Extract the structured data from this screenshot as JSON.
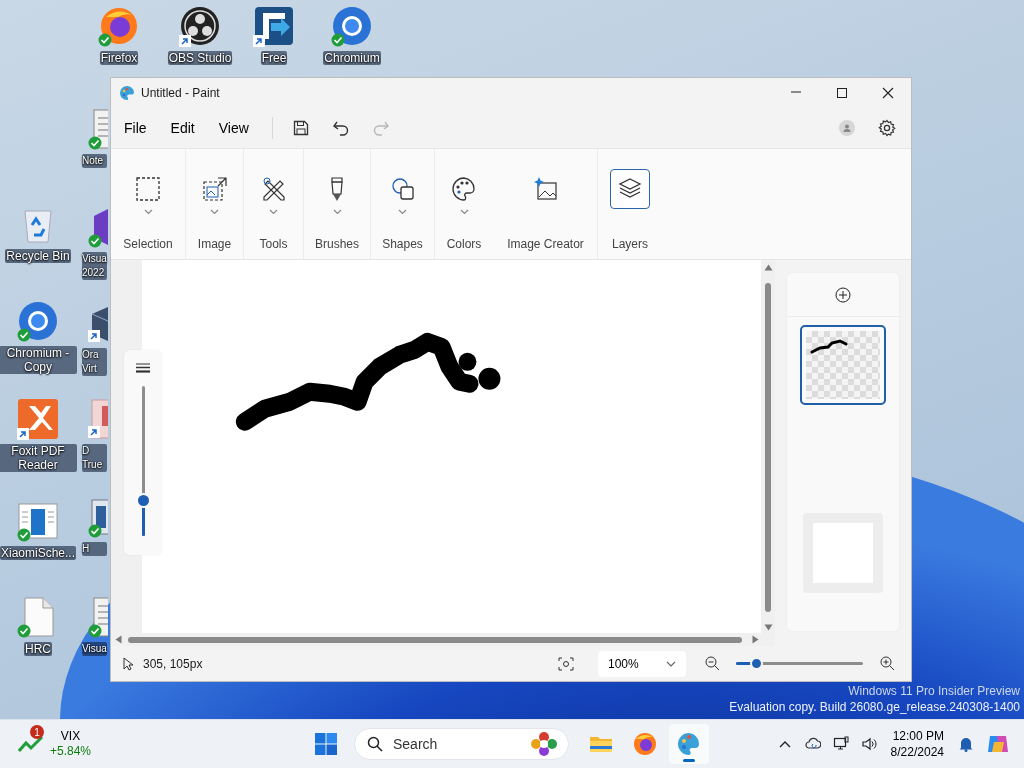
{
  "desktop": {
    "icons": [
      {
        "label": "Firefox",
        "kind": "synced"
      },
      {
        "label": "OBS Studio",
        "kind": "shortcut"
      },
      {
        "label": "Free",
        "kind": "shortcut"
      },
      {
        "label": "Chromium",
        "kind": "synced"
      },
      {
        "label": "Note",
        "kind": "synced"
      },
      {
        "label": "Recycle Bin",
        "kind": "plain"
      },
      {
        "label": "Visua 2022",
        "kind": "synced"
      },
      {
        "label": "Chromium - Copy",
        "kind": "synced"
      },
      {
        "label": "Ora Virt",
        "kind": "shortcut"
      },
      {
        "label": "Foxit PDF Reader",
        "kind": "shortcut"
      },
      {
        "label": "D True",
        "kind": "shortcut"
      },
      {
        "label": "XiaomiSche...",
        "kind": "synced"
      },
      {
        "label": "H",
        "kind": "synced"
      },
      {
        "label": "HRC",
        "kind": "synced"
      },
      {
        "label": "Visua",
        "kind": "synced"
      }
    ],
    "watermark": [
      "Windows 11 Pro Insider Preview",
      "Evaluation copy. Build 26080.ge_release.240308-1400"
    ]
  },
  "paint_window": {
    "title": "Untitled - Paint",
    "menu": [
      "File",
      "Edit",
      "View"
    ],
    "redo": {
      "disabled": true
    },
    "ribbon": [
      {
        "label": "Selection",
        "dropdown": true,
        "selected": false
      },
      {
        "label": "Image",
        "dropdown": true,
        "selected": false
      },
      {
        "label": "Tools",
        "dropdown": true,
        "selected": false
      },
      {
        "label": "Brushes",
        "dropdown": true,
        "selected": false
      },
      {
        "label": "Shapes",
        "dropdown": true,
        "selected": false
      },
      {
        "label": "Colors",
        "dropdown": true,
        "selected": false
      },
      {
        "label": "Image Creator",
        "dropdown": false,
        "selected": false
      },
      {
        "label": "Layers",
        "dropdown": false,
        "selected": true
      }
    ],
    "size_slider": {
      "level": 0.22
    },
    "layers": [
      {
        "kind": "drawing",
        "selected": true
      },
      {
        "kind": "blank",
        "selected": false
      }
    ],
    "status_bar": {
      "cursor_position": "305, 105px",
      "zoom": "100%",
      "zoom_slider": {
        "level": 0.16
      }
    }
  },
  "taskbar": {
    "widget": {
      "badge": "1",
      "title": "VIX",
      "change": "+5.84%"
    },
    "search": {
      "placeholder": "Search"
    },
    "apps": [
      {
        "selected": false
      },
      {
        "selected": false
      },
      {
        "selected": true
      }
    ],
    "clock": {
      "time": "12:00 PM",
      "date": "8/22/2024"
    }
  }
}
